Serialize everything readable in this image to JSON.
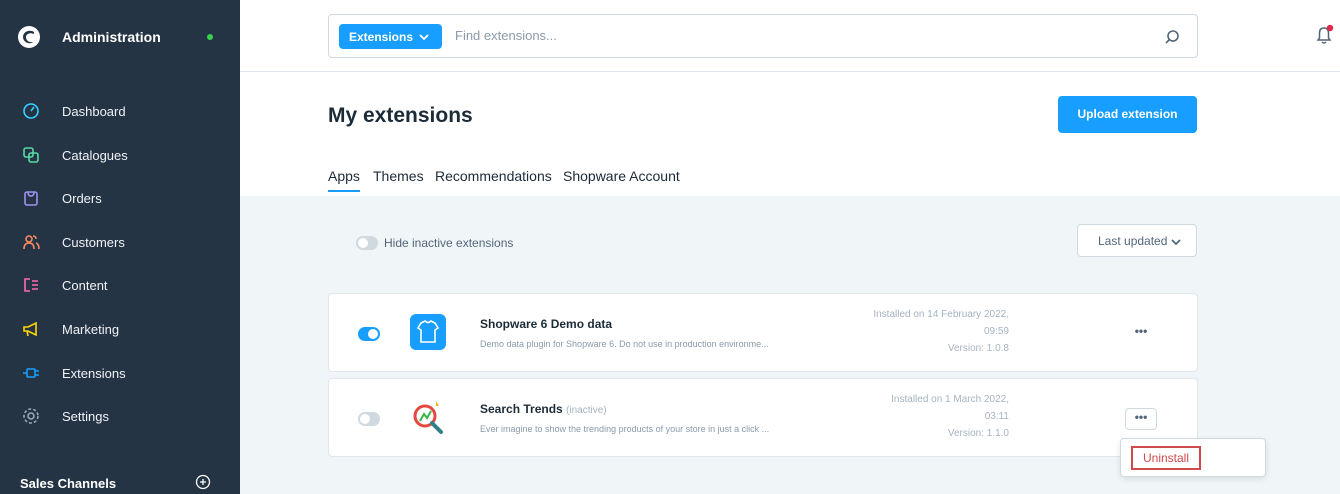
{
  "sidebar": {
    "title": "Administration",
    "items": [
      {
        "label": "Dashboard",
        "icon": "gauge-icon",
        "color": "#37d0ff"
      },
      {
        "label": "Catalogues",
        "icon": "catalogue-icon",
        "color": "#57d9a3"
      },
      {
        "label": "Orders",
        "icon": "shopping-bag-icon",
        "color": "#a092f0"
      },
      {
        "label": "Customers",
        "icon": "customers-icon",
        "color": "#f88962"
      },
      {
        "label": "Content",
        "icon": "content-icon",
        "color": "#ff68b4"
      },
      {
        "label": "Marketing",
        "icon": "megaphone-icon",
        "color": "#ffd700"
      },
      {
        "label": "Extensions",
        "icon": "plug-icon",
        "color": "#189eff"
      },
      {
        "label": "Settings",
        "icon": "gear-icon",
        "color": "#9aa8b5"
      }
    ],
    "sales_channels": "Sales Channels"
  },
  "search": {
    "type_label": "Extensions",
    "placeholder": "Find extensions..."
  },
  "page": {
    "title": "My extensions",
    "upload_label": "Upload extension",
    "tabs": [
      "Apps",
      "Themes",
      "Recommendations",
      "Shopware Account"
    ]
  },
  "filters": {
    "hide_inactive_label": "Hide inactive extensions",
    "sort_label": "Last updated"
  },
  "extensions": [
    {
      "name": "Shopware 6 Demo data",
      "status": "",
      "description": "Demo data plugin for Shopware 6. Do not use in production environme...",
      "installed_line1": "Installed on 14 February 2022,",
      "installed_line2": "09:59",
      "version": "Version: 1.0.8",
      "active": true
    },
    {
      "name": "Search Trends",
      "status": "(inactive)",
      "description": "Ever imagine to show the trending products of your store in just a click ...",
      "installed_line1": "Installed on 1 March 2022,",
      "installed_line2": "03:11",
      "version": "Version: 1.1.0",
      "active": false
    }
  ],
  "context_menu": {
    "uninstall_label": "Uninstall"
  },
  "colors": {
    "accent": "#189eff",
    "sidebar_bg": "#253445",
    "danger": "#d04a4a"
  }
}
